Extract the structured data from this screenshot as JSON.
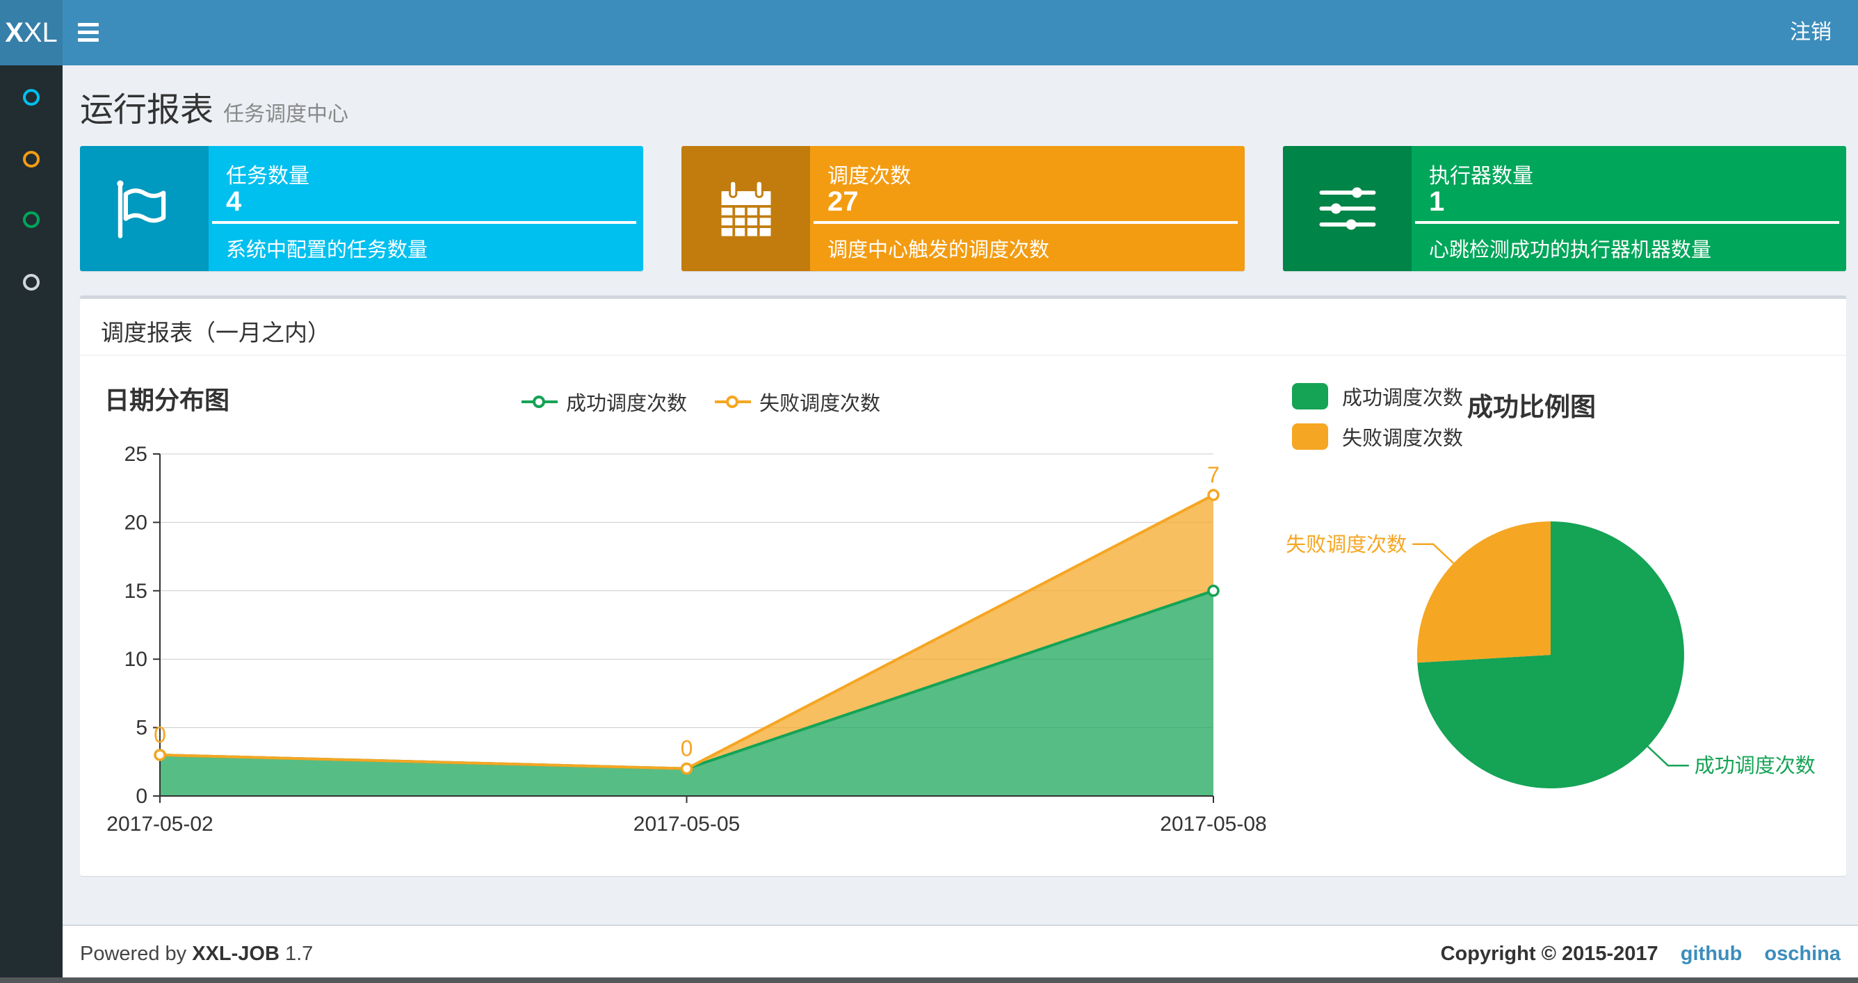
{
  "navbar": {
    "logo_bold": "X",
    "logo_rest": "XL",
    "logout_label": "注销"
  },
  "sidebar": {
    "items": [
      {
        "icon": "circle-icon",
        "color": "#00c0ef"
      },
      {
        "icon": "circle-icon",
        "color": "#f39c12"
      },
      {
        "icon": "circle-icon",
        "color": "#00a65a"
      },
      {
        "icon": "circle-icon",
        "color": "#d2d6de"
      }
    ]
  },
  "page_header": {
    "title": "运行报表",
    "subtitle": "任务调度中心"
  },
  "info_boxes": [
    {
      "icon": "flag-icon",
      "label": "任务数量",
      "value": "4",
      "description": "系统中配置的任务数量",
      "color": "#00c0ef"
    },
    {
      "icon": "calendar-icon",
      "label": "调度次数",
      "value": "27",
      "description": "调度中心触发的调度次数",
      "color": "#f39c12"
    },
    {
      "icon": "sliders-icon",
      "label": "执行器数量",
      "value": "1",
      "description": "心跳检测成功的执行器机器数量",
      "color": "#00a65a"
    }
  ],
  "panel": {
    "title": "调度报表（一月之内）"
  },
  "chart_data": [
    {
      "type": "area",
      "title": "日期分布图",
      "stacked": true,
      "x": [
        "2017-05-02",
        "2017-05-05",
        "2017-05-08"
      ],
      "series": [
        {
          "name": "成功调度次数",
          "values": [
            3,
            2,
            15
          ],
          "color": "#15a356"
        },
        {
          "name": "失败调度次数",
          "values": [
            0,
            0,
            7
          ],
          "color": "#f5a623",
          "point_labels": [
            "0",
            "0",
            "7"
          ]
        }
      ],
      "ylim": [
        0,
        25
      ],
      "yticks": [
        0,
        5,
        10,
        15,
        20,
        25
      ],
      "grid": true,
      "legend_position": "top"
    },
    {
      "type": "pie",
      "title": "成功比例图",
      "slices": [
        {
          "name": "成功调度次数",
          "value": 20,
          "color": "#15a356"
        },
        {
          "name": "失败调度次数",
          "value": 7,
          "color": "#f5a623"
        }
      ],
      "start_angle": "top",
      "clockwise": true,
      "legend_position": "top-left"
    }
  ],
  "footer": {
    "powered_by": "Powered by",
    "product": "XXL-JOB",
    "version": "1.7",
    "copyright": "Copyright © 2015-2017",
    "links": [
      {
        "label": "github"
      },
      {
        "label": "oschina"
      }
    ]
  },
  "colors": {
    "navbar": "#3c8dbc",
    "logo_bg": "#367fa9",
    "sidebar_bg": "#222d32",
    "content_bg": "#ecf0f5",
    "link": "#3c8dbc"
  }
}
